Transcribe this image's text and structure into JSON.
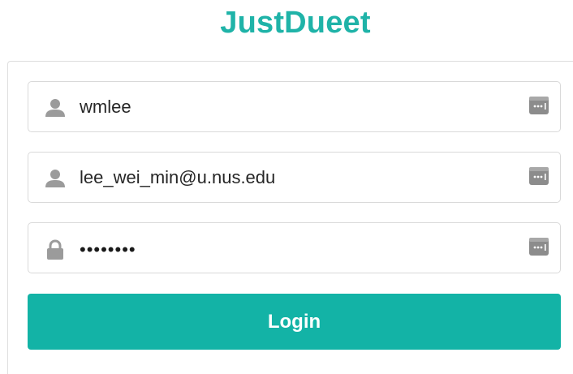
{
  "app": {
    "title": "JustDueet"
  },
  "form": {
    "username": {
      "value": "wmlee",
      "icon": "user-icon"
    },
    "email": {
      "value": "lee_wei_min@u.nus.edu",
      "icon": "user-icon"
    },
    "password": {
      "value": "••••••••",
      "icon": "lock-icon"
    },
    "login_label": "Login"
  },
  "colors": {
    "accent": "#13b3a6",
    "title": "#1fb3a8",
    "icon": "#9b9b9b"
  }
}
